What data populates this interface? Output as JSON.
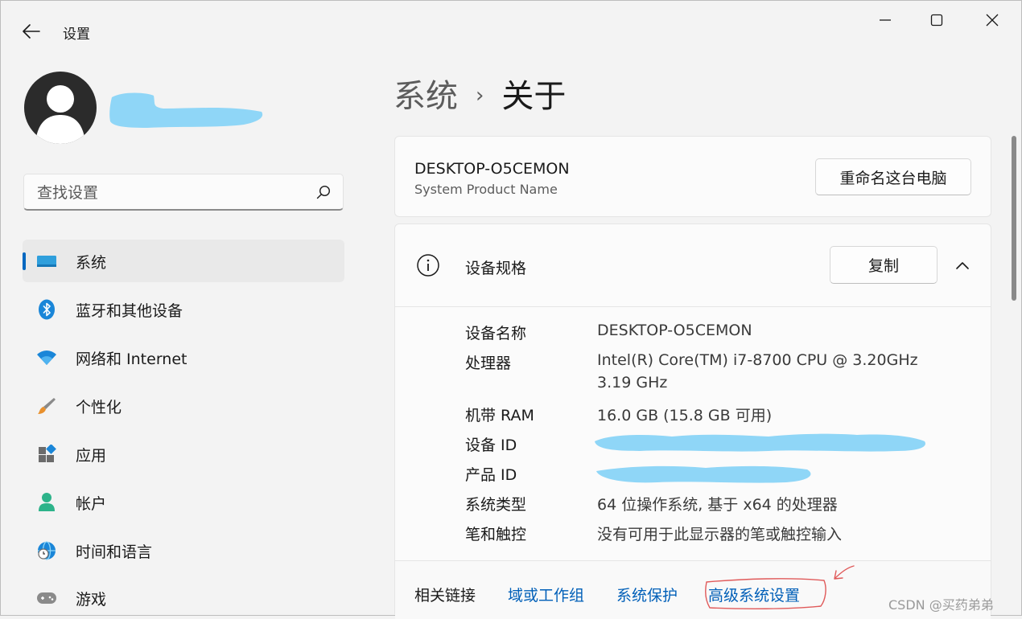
{
  "window": {
    "title": "设置",
    "minimize_icon": "minimize-icon",
    "maximize_icon": "maximize-icon",
    "close_icon": "close-icon"
  },
  "search": {
    "placeholder": "查找设置"
  },
  "sidebar": {
    "items": [
      {
        "label": "系统",
        "icon": "system-icon",
        "active": true
      },
      {
        "label": "蓝牙和其他设备",
        "icon": "bluetooth-icon"
      },
      {
        "label": "网络和 Internet",
        "icon": "wifi-icon"
      },
      {
        "label": "个性化",
        "icon": "brush-icon"
      },
      {
        "label": "应用",
        "icon": "apps-icon"
      },
      {
        "label": "帐户",
        "icon": "account-icon"
      },
      {
        "label": "时间和语言",
        "icon": "globe-clock-icon"
      },
      {
        "label": "游戏",
        "icon": "gamepad-icon"
      }
    ]
  },
  "breadcrumb": {
    "parent": "系统",
    "separator": "›",
    "current": "关于"
  },
  "device": {
    "name": "DESKTOP-O5CEMON",
    "model": "System Product Name",
    "rename_label": "重命名这台电脑"
  },
  "specs": {
    "title": "设备规格",
    "copy_label": "复制",
    "rows": [
      {
        "label": "设备名称",
        "value": "DESKTOP-O5CEMON"
      },
      {
        "label": "处理器",
        "value": "Intel(R) Core(TM) i7-8700 CPU @ 3.20GHz",
        "value2": "3.19 GHz"
      },
      {
        "label": "机带 RAM",
        "value": "16.0 GB (15.8 GB 可用)"
      },
      {
        "label": "设备 ID",
        "value": ""
      },
      {
        "label": "产品 ID",
        "value": ""
      },
      {
        "label": "系统类型",
        "value": "64 位操作系统, 基于 x64 的处理器"
      },
      {
        "label": "笔和触控",
        "value": "没有可用于此显示器的笔或触控输入"
      }
    ]
  },
  "related": {
    "label": "相关链接",
    "links": [
      "域或工作组",
      "系统保护",
      "高级系统设置"
    ]
  },
  "watermark": "CSDN @买药弟弟",
  "colors": {
    "accent": "#0067c0",
    "link": "#005fb8",
    "redaction": "#8fd6f7",
    "annotation": "#e05a5a"
  }
}
